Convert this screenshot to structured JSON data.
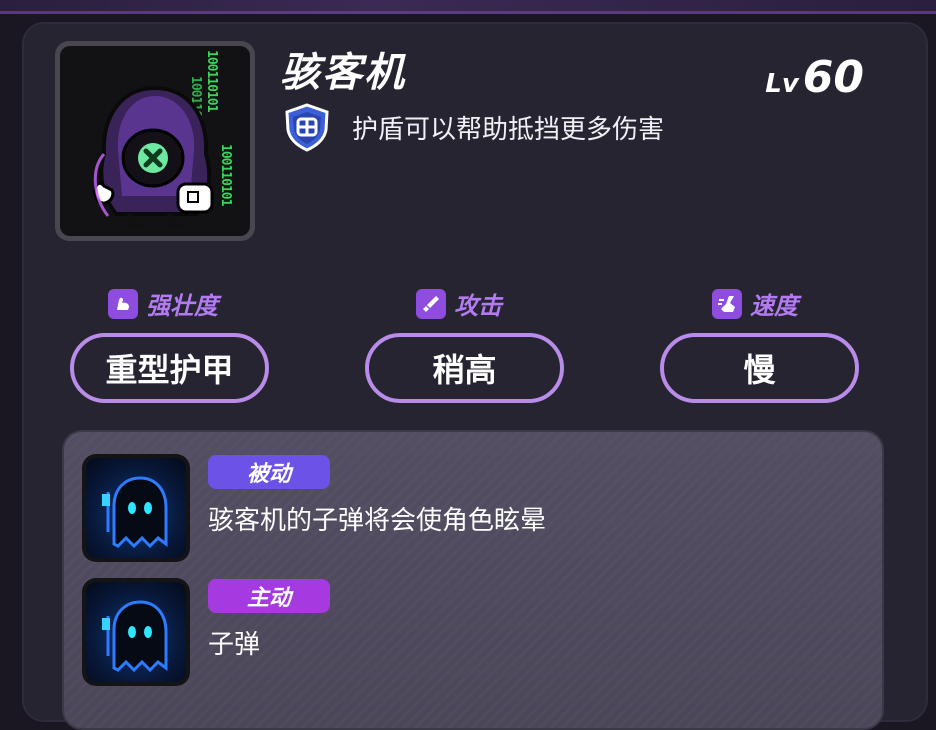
{
  "character": {
    "name": "骇客机",
    "level_prefix": "Lv",
    "level": "60",
    "trait": "护盾可以帮助抵挡更多伤害",
    "trait_icon": "shield-icon",
    "portrait_code": [
      "100110101",
      "1001101",
      "100110101",
      "10"
    ]
  },
  "stats": [
    {
      "label": "强壮度",
      "icon": "flexed-arm-icon",
      "value": "重型护甲"
    },
    {
      "label": "攻击",
      "icon": "sword-icon",
      "value": "稍高"
    },
    {
      "label": "速度",
      "icon": "boot-icon",
      "value": "慢"
    }
  ],
  "skills": [
    {
      "tag": "被动",
      "desc": "骇客机的子弹将会使角色眩晕",
      "icon": "ghost-icon"
    },
    {
      "tag": "主动",
      "desc": "子弹",
      "icon": "ghost-icon"
    }
  ],
  "colors": {
    "accent": "#b88ce8",
    "stat_label": "#b27bf2",
    "passive_tag": "#6c52e6",
    "active_tag": "#a43ae0",
    "code_green": "#39d65a"
  }
}
